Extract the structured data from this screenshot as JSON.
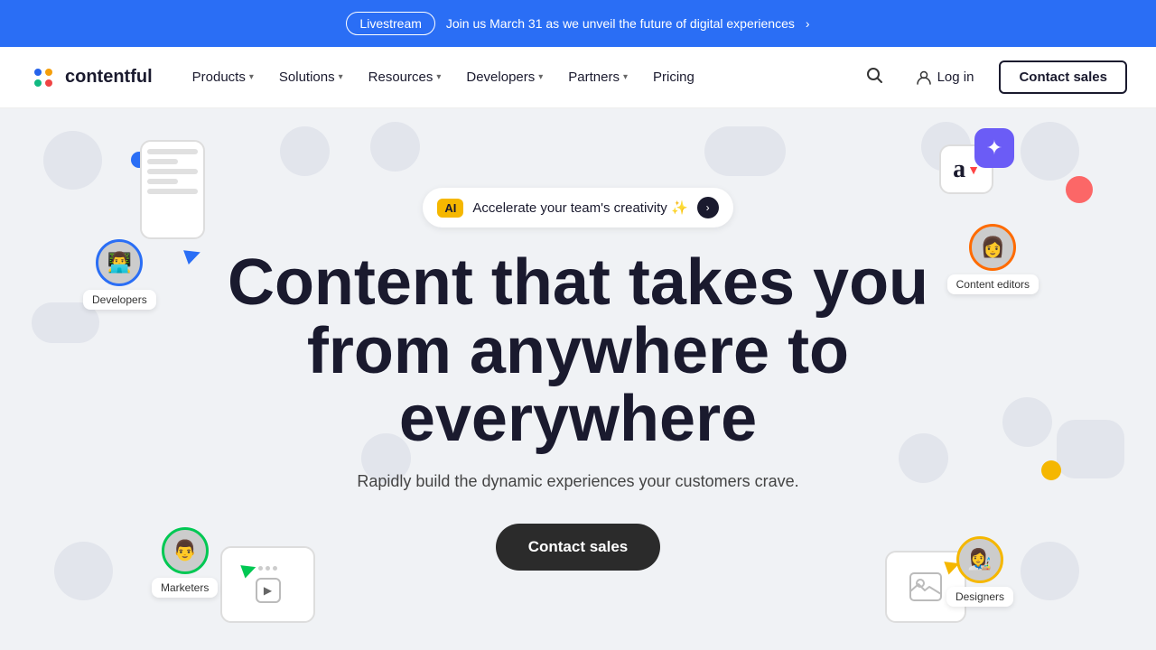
{
  "banner": {
    "livestream_label": "Livestream",
    "text": "Join us March 31 as we unveil the future of digital experiences",
    "arrow": "›"
  },
  "nav": {
    "logo_text": "contentful",
    "links": [
      {
        "label": "Products",
        "has_dropdown": true
      },
      {
        "label": "Solutions",
        "has_dropdown": true
      },
      {
        "label": "Resources",
        "has_dropdown": true
      },
      {
        "label": "Developers",
        "has_dropdown": true
      },
      {
        "label": "Partners",
        "has_dropdown": true
      },
      {
        "label": "Pricing",
        "has_dropdown": false
      }
    ],
    "login_label": "Log in",
    "contact_label": "Contact sales"
  },
  "hero": {
    "ai_badge": "AI",
    "ai_text": "Accelerate your team's creativity ✨",
    "title_line1": "Content that takes you",
    "title_line2": "from anywhere to",
    "title_line3": "everywhere",
    "subtitle": "Rapidly build the dynamic experiences your customers crave.",
    "cta_label": "Contact sales",
    "personas": [
      {
        "label": "Developers",
        "emoji": "👨‍💻"
      },
      {
        "label": "Marketers",
        "emoji": "👨"
      },
      {
        "label": "Content editors",
        "emoji": "👩"
      },
      {
        "label": "Designers",
        "emoji": "👩‍🎨"
      }
    ]
  }
}
